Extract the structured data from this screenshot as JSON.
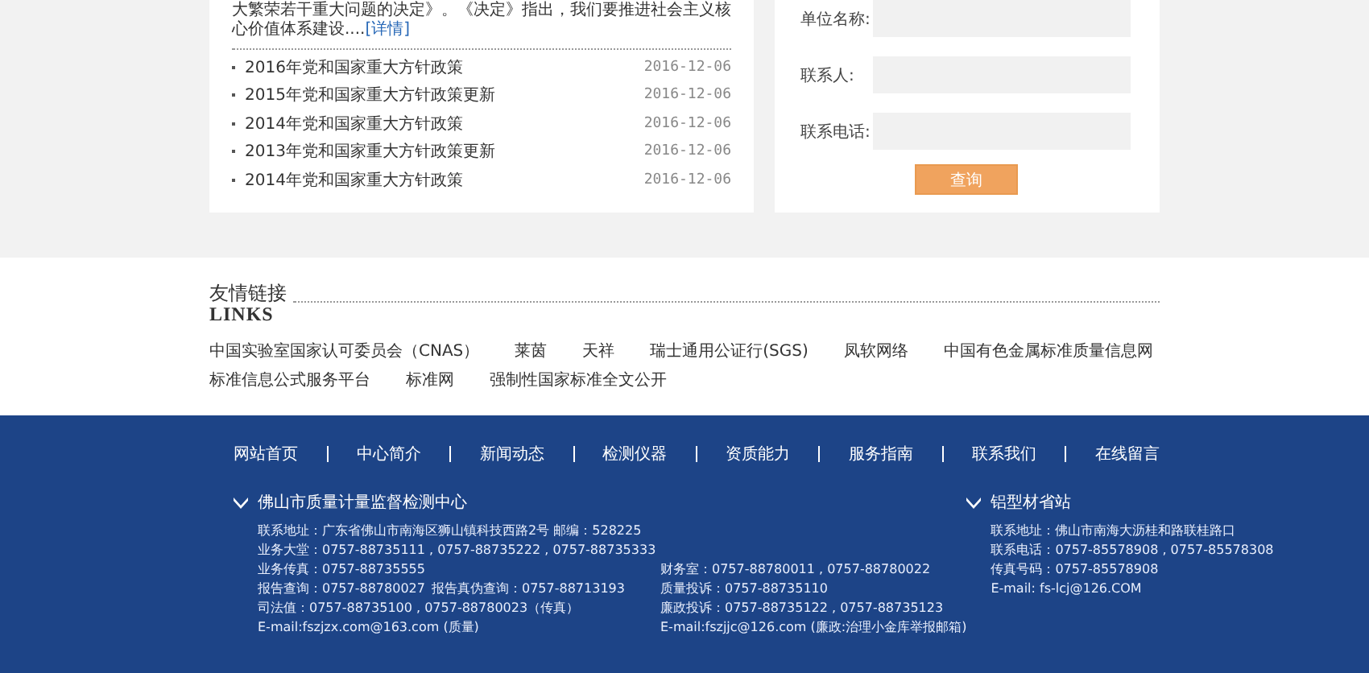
{
  "news": {
    "summary": "大繁荣若干重大问题的决定》。《决定》指出，我们要推进社会主义核心价值体系建设....",
    "more": "[详情]",
    "items": [
      {
        "title": "2016年党和国家重大方针政策",
        "date": "2016-12-06"
      },
      {
        "title": "2015年党和国家重大方针政策更新",
        "date": "2016-12-06"
      },
      {
        "title": "2014年党和国家重大方针政策",
        "date": "2016-12-06"
      },
      {
        "title": "2013年党和国家重大方针政策更新",
        "date": "2016-12-06"
      },
      {
        "title": "2014年党和国家重大方针政策",
        "date": "2016-12-06"
      }
    ]
  },
  "query_form": {
    "fields": [
      {
        "label": "单位名称:"
      },
      {
        "label": "联系人:"
      },
      {
        "label": "联系电话:"
      }
    ],
    "button": "查询"
  },
  "links": {
    "title": "友情链接",
    "subtitle": "LINKS",
    "items": [
      "中国实验室国家认可委员会（CNAS）",
      "莱茵",
      "天祥",
      "瑞士通用公证行(SGS)",
      "凤软网络",
      "中国有色金属标准质量信息网",
      "标准信息公式服务平台",
      "标准网",
      "强制性国家标准全文公开"
    ]
  },
  "footer": {
    "nav": [
      "网站首页",
      "中心简介",
      "新闻动态",
      "检测仪器",
      "资质能力",
      "服务指南",
      "联系我们",
      "在线留言"
    ],
    "sections": [
      {
        "title": "佛山市质量计量监督检测中心",
        "lines": [
          [
            "联系地址：广东省佛山市南海区狮山镇科技西路2号 邮编：528225"
          ],
          [
            "业务大堂：0757-88735111 , 0757-88735222 , 0757-88735333"
          ],
          [
            "业务传真：0757-88735555",
            "财务室：0757-88780011 , 0757-88780022"
          ],
          [
            "报告查询：0757-88780027",
            "报告真伪查询：0757-88713193",
            "质量投诉：0757-88735110"
          ],
          [
            "司法值：0757-88735100 , 0757-88780023（传真）",
            "廉政投诉：0757-88735122 , 0757-88735123"
          ],
          [
            "E-mail:fszjzx.com@163.com (质量)",
            "E-mail:fszjjc@126.com (廉政:治理小金库举报邮箱)"
          ]
        ]
      },
      {
        "title": "铝型材省站",
        "lines": [
          [
            "联系地址：佛山市南海大沥桂和路联桂路口"
          ],
          [
            "联系电话：0757-85578908 , 0757-85578308"
          ],
          [
            "传真号码：0757-85578908"
          ],
          [
            "E-mail: fs-lcj@126.COM"
          ]
        ]
      }
    ]
  }
}
